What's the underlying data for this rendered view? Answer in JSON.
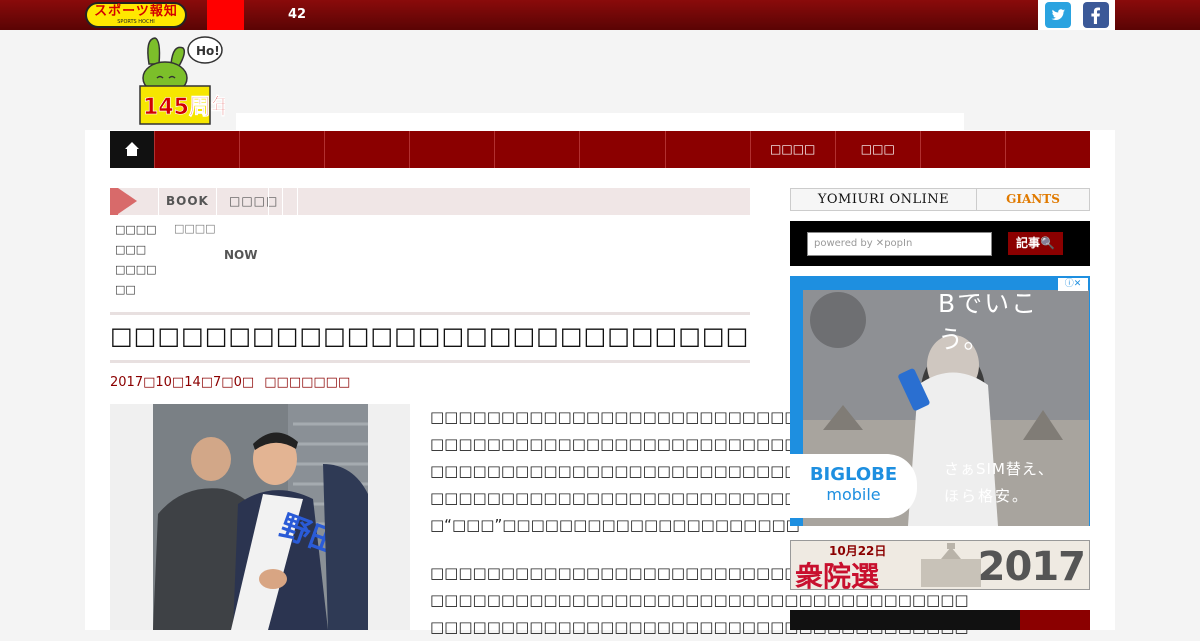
{
  "header": {
    "logo_text": "スポーツ報知",
    "logo_sub": "SPORTS HOCHI",
    "notification_count": "42",
    "anniversary": "145周年",
    "mascot_bubble": "Ho!"
  },
  "nav": {
    "items": [
      "",
      "",
      "",
      "",
      "",
      "",
      "",
      "",
      "",
      "",
      "",
      ""
    ]
  },
  "breadcrumb": {
    "book": "BOOK",
    "second": "□□□□"
  },
  "subnav": {
    "col1": [
      "□□□□",
      "□□□",
      "□□□□",
      "□□"
    ],
    "col2": "□□□□",
    "now": "NOW"
  },
  "article": {
    "title": "□□□□□□□□□□□□□□□□□□□□□□□□□□□□□□□□□□□□□□□□□□□□□□□□□□□□□□□□□□",
    "date": "2017□10□14□7□0□",
    "source": "□□□□□□□",
    "paragraph1": [
      "□□□□□□□□□□□□□□□□□□□□□□□□□□□□□□□□□□□□□□",
      "□□□□□□□□□□□□□□□□□□□□□□□□□□□□□□□□□□□□□□",
      "□□□□□□□□□□□□□□□□□□□□□□□□□□□□□□□□□□□□□□",
      "□□□□□□□□□□□□□□□□□□□□□□□□□□□□□□□□□□□□□□",
      "□“□□□”□□□□□□□□□□□□□□□□□□□□□"
    ],
    "paragraph2": [
      "□□□□□□□□□□□□□□□□□□□□□□□□□□□□□□□□□□□□□□",
      "□□□□□□□□□□□□□□□□□□□□□□□□□□□□□□□□□□□□□□",
      "□□□□□□□□□□□□□□□□□□□□□□□□□□□□□□□□□□□□□□"
    ]
  },
  "sidebar": {
    "yomiuri": "YOMIURI ONLINE",
    "giants": "GIANTS",
    "search_placeholder": "powered by ✕popIn",
    "search_button": "記事🔍",
    "ad": {
      "headline": "Bでいこう。",
      "brand1": "BIGLOBE",
      "brand2": "mobile",
      "sub1": "さぁSIM替え、",
      "sub2": "ほら格安。",
      "adchoice": "ⓘ✕"
    },
    "election": {
      "date": "10月22日",
      "name": "衆院選",
      "year": "2017"
    }
  }
}
